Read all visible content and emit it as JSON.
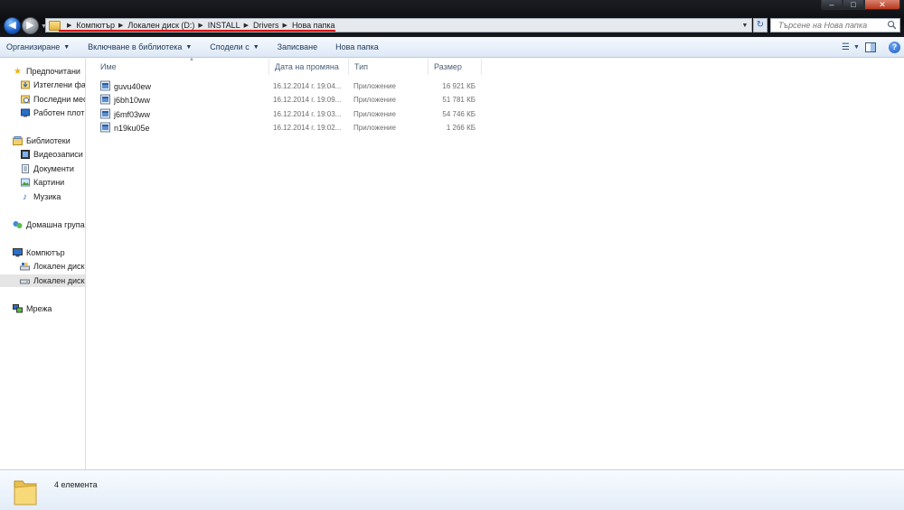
{
  "window": {
    "controls": {
      "minimize": "–",
      "maximize": "□",
      "close": "✕"
    }
  },
  "address": {
    "crumbs": [
      "Компютър",
      "Локален диск (D:)",
      "INSTALL",
      "Drivers",
      "Нова папка"
    ]
  },
  "search": {
    "placeholder": "Търсене на Нова папка"
  },
  "toolbar": {
    "organize": "Организиране",
    "include_in_library": "Включване в библиотека",
    "share_with": "Сподели с",
    "burn": "Записване",
    "new_folder": "Нова папка"
  },
  "navigation": {
    "favorites": "Предпочитани",
    "downloads": "Изтеглени фай",
    "recent": "Последни мес",
    "desktop": "Работен плот",
    "libraries": "Библиотеки",
    "videos": "Видеозаписи",
    "documents": "Документи",
    "pictures": "Картини",
    "music": "Музика",
    "homegroup": "Домашна група",
    "computer": "Компютър",
    "local_disk_c": "Локален диск",
    "local_disk_d": "Локален диск",
    "network": "Мрежа"
  },
  "columns": {
    "name": "Име",
    "date": "Дата на промяна",
    "type": "Тип",
    "size": "Размер"
  },
  "files": [
    {
      "name": "guvu40ew",
      "date": "16.12.2014 г. 19:04...",
      "type": "Приложение",
      "size": "16 921 КБ"
    },
    {
      "name": "j6bh10ww",
      "date": "16.12.2014 г. 19:09...",
      "type": "Приложение",
      "size": "51 781 КБ"
    },
    {
      "name": "j6mf03ww",
      "date": "16.12.2014 г. 19:03...",
      "type": "Приложение",
      "size": "54 746 КБ"
    },
    {
      "name": "n19ku05e",
      "date": "16.12.2014 г. 19:02...",
      "type": "Приложение",
      "size": "1 266 КБ"
    }
  ],
  "status": {
    "item_count": "4 елемента"
  }
}
